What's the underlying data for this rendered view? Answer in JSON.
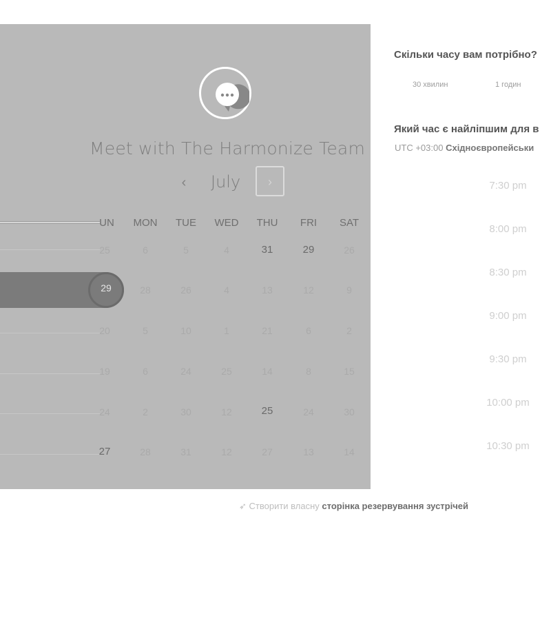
{
  "calendar": {
    "title": "Meet with The Harmonize Team",
    "month": "July",
    "prev_glyph": "‹",
    "next_glyph": "›",
    "days_of_week": [
      "UN",
      "MON",
      "TUE",
      "WED",
      "THU",
      "FRI",
      "SAT"
    ],
    "weeks": [
      [
        "25",
        "6",
        "5",
        "4",
        "31",
        "29",
        "26"
      ],
      [
        "29",
        "28",
        "26",
        "4",
        "13",
        "12",
        "9"
      ],
      [
        "20",
        "5",
        "10",
        "1",
        "21",
        "6",
        "2"
      ],
      [
        "19",
        "6",
        "24",
        "25",
        "14",
        "8",
        "15"
      ],
      [
        "24",
        "2",
        "30",
        "12",
        "25",
        "24",
        "30"
      ],
      [
        "27",
        "28",
        "31",
        "12",
        "27",
        "13",
        "14"
      ]
    ],
    "selected_day": "29",
    "logo_icon": "chat-bubble-icon"
  },
  "booking": {
    "duration_question": "Скільки часу вам потрібно?",
    "durations": [
      "30 хвилин",
      "1 годин"
    ],
    "time_question": "Який час є найліпшим для в",
    "timezone_offset": "UTC +03:00",
    "timezone_name": "Східноєвропейськи",
    "slots": [
      "7:30 pm",
      "8:00 pm",
      "8:30 pm",
      "9:00 pm",
      "9:30 pm",
      "10:00 pm",
      "10:30 pm"
    ]
  },
  "footer": {
    "icon": "rocket-icon",
    "prefix": "Створити власну",
    "link": "сторінка резервування зустрічей"
  }
}
